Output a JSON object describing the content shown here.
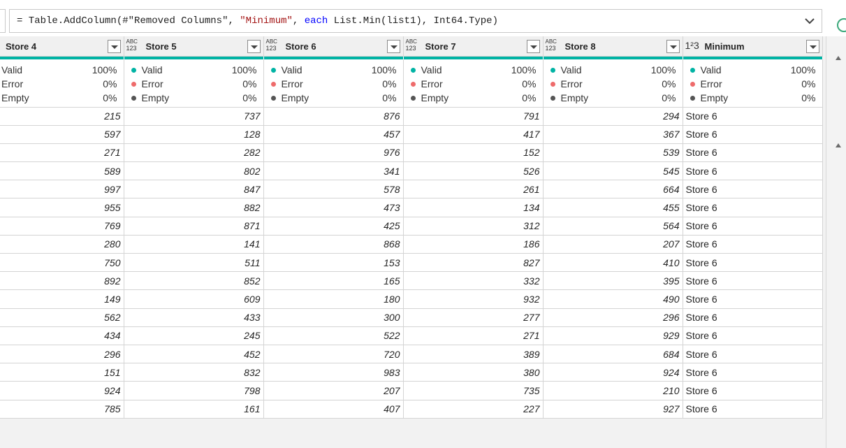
{
  "formula_bar": {
    "formula_parts": [
      {
        "text": "= Table.AddColumn(#",
        "style": "plain"
      },
      {
        "text": "\"Removed Columns\"",
        "style": "plain"
      },
      {
        "text": ", ",
        "style": "plain"
      },
      {
        "text": "\"Minimum\"",
        "style": "string"
      },
      {
        "text": ", ",
        "style": "plain"
      },
      {
        "text": "each",
        "style": "keyword"
      },
      {
        "text": " List.Min(list1), Int64.Type)",
        "style": "plain"
      }
    ],
    "expand_icon": "chevron-down-icon"
  },
  "columns": [
    {
      "name": "Store 4",
      "type": "any",
      "valid": "100%",
      "error": "0%",
      "empty": "0%"
    },
    {
      "name": "Store 5",
      "type": "any",
      "valid": "100%",
      "error": "0%",
      "empty": "0%"
    },
    {
      "name": "Store 6",
      "type": "any",
      "valid": "100%",
      "error": "0%",
      "empty": "0%"
    },
    {
      "name": "Store 7",
      "type": "any",
      "valid": "100%",
      "error": "0%",
      "empty": "0%"
    },
    {
      "name": "Store 8",
      "type": "any",
      "valid": "100%",
      "error": "0%",
      "empty": "0%"
    },
    {
      "name": "Minimum",
      "type": "whole-number",
      "valid": "100%",
      "error": "0%",
      "empty": "0%"
    }
  ],
  "profile_labels": {
    "valid": "Valid",
    "error": "Error",
    "empty": "Empty"
  },
  "type_icon_text": {
    "any_top": "ABC",
    "any_bottom": "123",
    "whole_number": "1²3"
  },
  "rows": [
    [
      "215",
      "737",
      "876",
      "791",
      "294",
      "Store 6"
    ],
    [
      "597",
      "128",
      "457",
      "417",
      "367",
      "Store 6"
    ],
    [
      "271",
      "282",
      "976",
      "152",
      "539",
      "Store 6"
    ],
    [
      "589",
      "802",
      "341",
      "526",
      "545",
      "Store 6"
    ],
    [
      "997",
      "847",
      "578",
      "261",
      "664",
      "Store 6"
    ],
    [
      "955",
      "882",
      "473",
      "134",
      "455",
      "Store 6"
    ],
    [
      "769",
      "871",
      "425",
      "312",
      "564",
      "Store 6"
    ],
    [
      "280",
      "141",
      "868",
      "186",
      "207",
      "Store 6"
    ],
    [
      "750",
      "511",
      "153",
      "827",
      "410",
      "Store 6"
    ],
    [
      "892",
      "852",
      "165",
      "332",
      "395",
      "Store 6"
    ],
    [
      "149",
      "609",
      "180",
      "932",
      "490",
      "Store 6"
    ],
    [
      "562",
      "433",
      "300",
      "277",
      "296",
      "Store 6"
    ],
    [
      "434",
      "245",
      "522",
      "271",
      "929",
      "Store 6"
    ],
    [
      "296",
      "452",
      "720",
      "389",
      "684",
      "Store 6"
    ],
    [
      "151",
      "832",
      "983",
      "380",
      "924",
      "Store 6"
    ],
    [
      "924",
      "798",
      "207",
      "735",
      "210",
      "Store 6"
    ],
    [
      "785",
      "161",
      "407",
      "227",
      "927",
      "Store 6"
    ]
  ],
  "colors": {
    "quality_bar": "#00b3a4",
    "valid": "#00b3a4",
    "error": "#ee6b6b",
    "empty": "#555555",
    "keyword": "#0000ff",
    "string": "#a31515"
  }
}
